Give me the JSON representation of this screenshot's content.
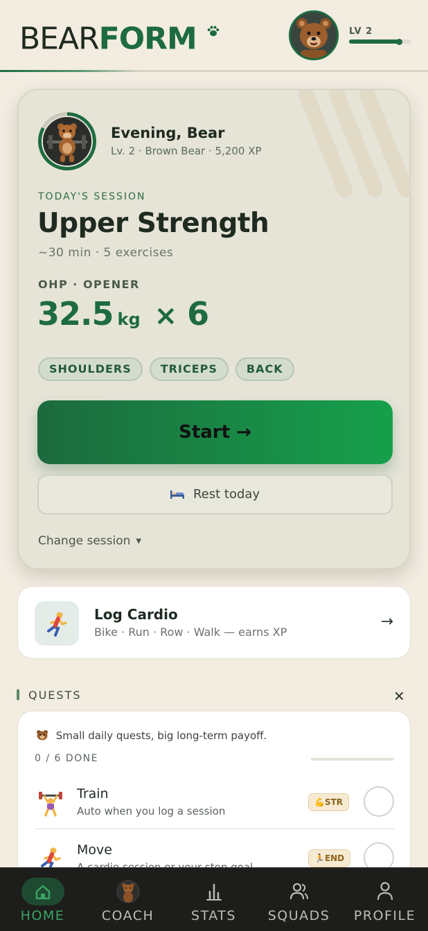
{
  "header": {
    "logo_part1": "BEAR",
    "logo_part2": "FORM",
    "logo_glyph": "paw-icon",
    "level_label": "LV 2",
    "level_progress": 0.82
  },
  "session": {
    "greeting": "Evening, Bear",
    "subtitle": "Lv. 2 · Brown Bear · 5,200 XP",
    "section_label": "TODAY'S SESSION",
    "title": "Upper Strength",
    "meta": "~30 min · 5 exercises",
    "lift_label": "OHP · OPENER",
    "lift_weight": "32.5",
    "lift_unit": "kg",
    "lift_times": "×",
    "lift_reps": "6",
    "chips": [
      "SHOULDERS",
      "TRICEPS",
      "BACK"
    ],
    "start_label": "Start →",
    "rest_icon": "bed-icon",
    "rest_label": "Rest today",
    "change_label": "Change session",
    "avatar_progress": 0.83
  },
  "cardio": {
    "title": "Log Cardio",
    "subtitle": "Bike · Run · Row · Walk — earns XP",
    "icon": "runner-icon"
  },
  "quests": {
    "label": "QUESTS",
    "intro": "Small daily quests, big long-term payoff.",
    "count": "0 / 6 DONE",
    "progress": 0,
    "items": [
      {
        "title": "Train",
        "subtitle": "Auto when you log a session",
        "badge": "💪STR",
        "icon": "weightlifter-icon"
      },
      {
        "title": "Move",
        "subtitle": "A cardio session or your step goal",
        "badge": "🏃END",
        "icon": "runner-icon"
      }
    ]
  },
  "nav": {
    "items": [
      {
        "label": "HOME",
        "icon": "home-icon",
        "active": true
      },
      {
        "label": "COACH",
        "icon": "coach-avatar-icon",
        "active": false
      },
      {
        "label": "STATS",
        "icon": "bar-chart-icon",
        "active": false
      },
      {
        "label": "SQUADS",
        "icon": "people-icon",
        "active": false
      },
      {
        "label": "PROFILE",
        "icon": "person-icon",
        "active": false
      }
    ]
  },
  "colors": {
    "brand_green": "#1e6b40",
    "accent_green": "#16a04b",
    "background": "#f2ece1",
    "nav_background": "#1d1d1b"
  }
}
